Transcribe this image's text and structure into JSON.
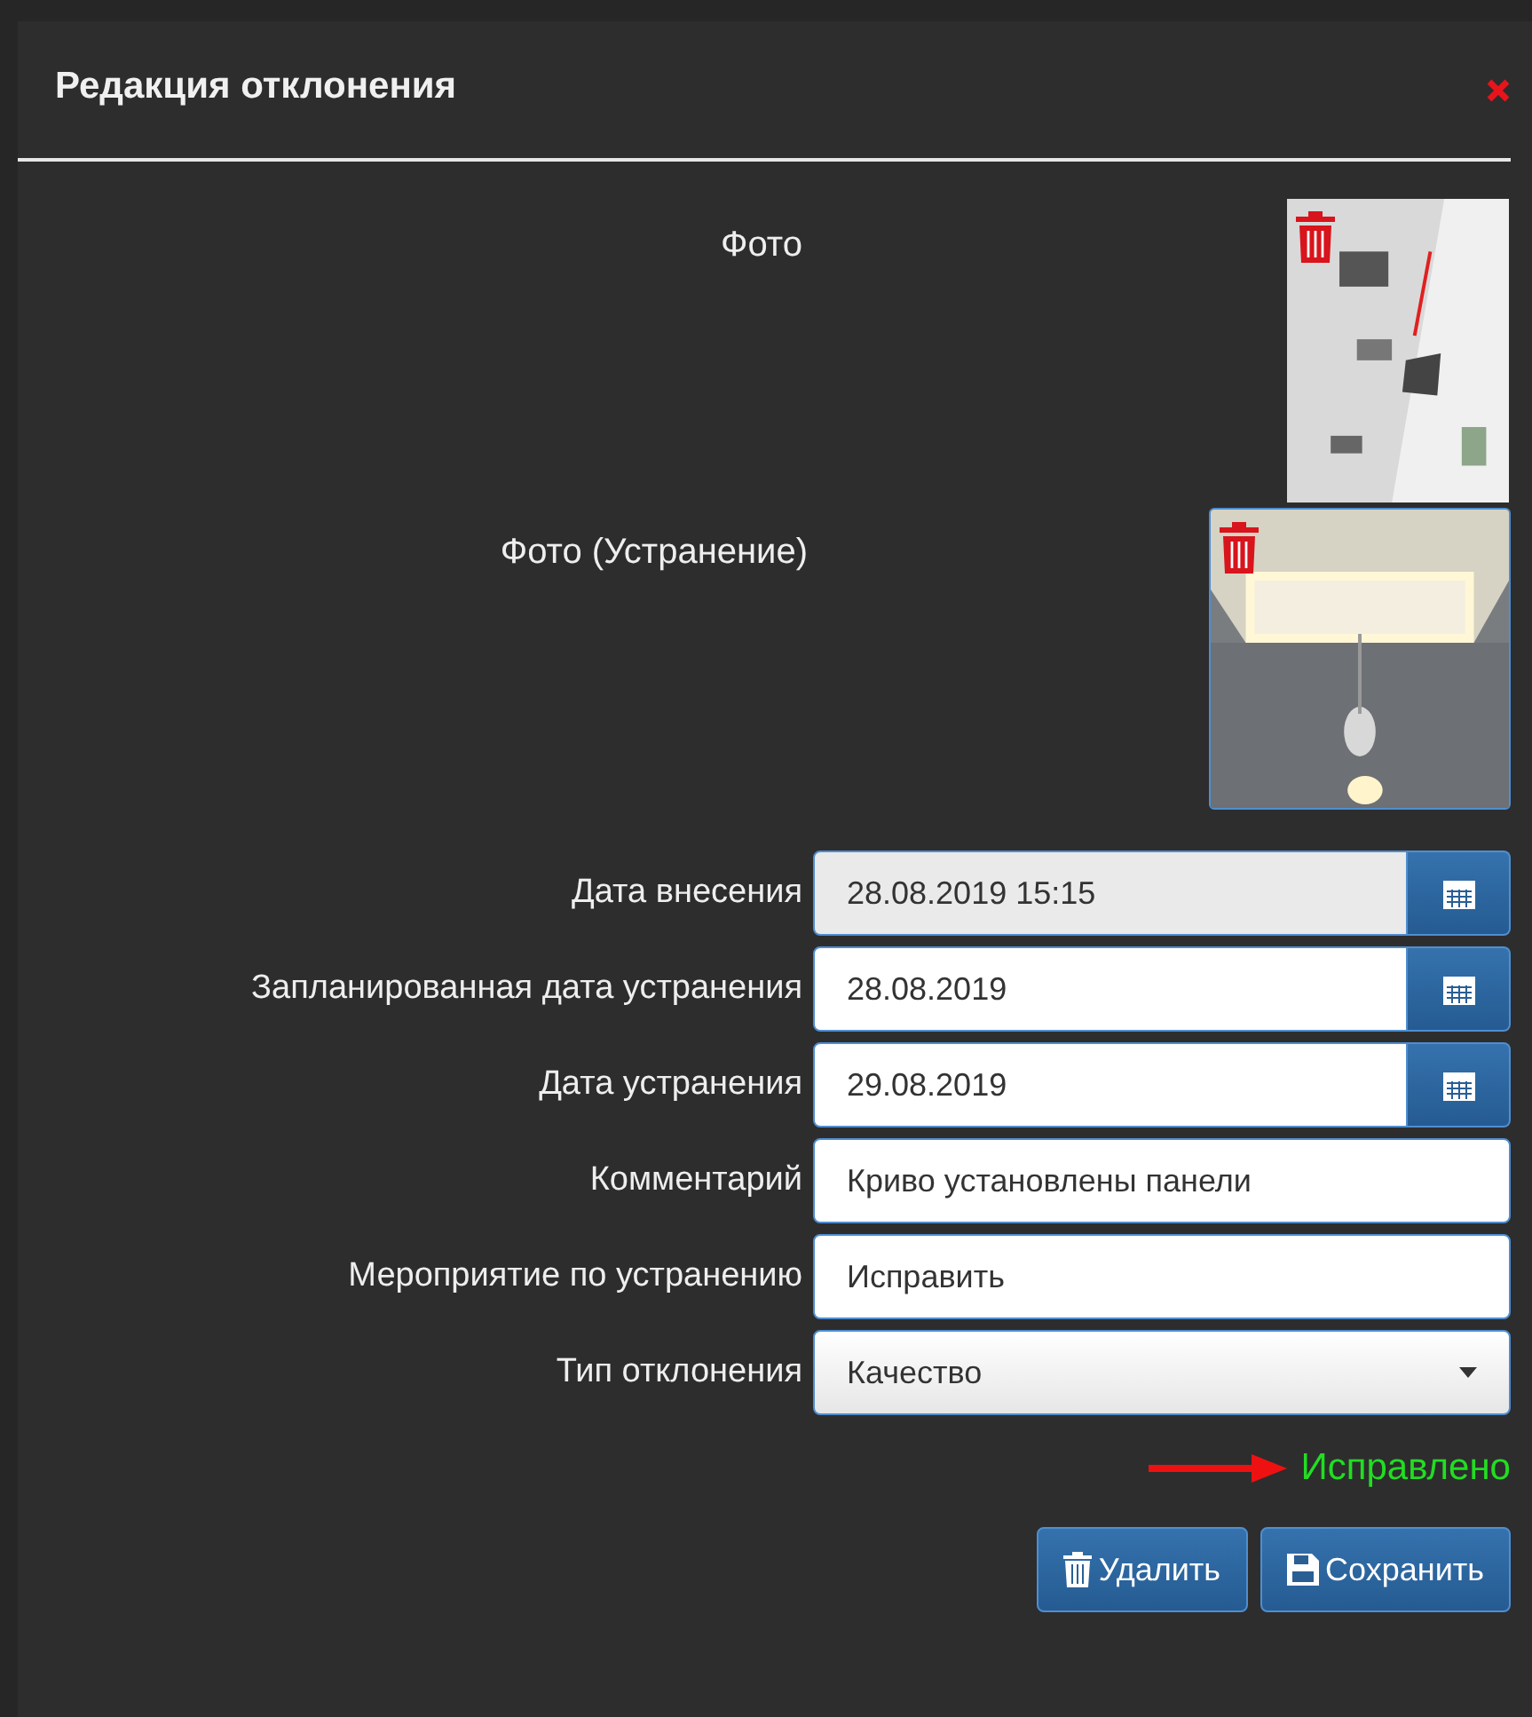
{
  "dialog": {
    "title": "Редакция отклонения"
  },
  "photos": [
    {
      "label": "Фото",
      "highlighted": false
    },
    {
      "label": "Фото (Устранение)",
      "highlighted": true
    }
  ],
  "fields": [
    {
      "label": "Дата внесения",
      "value": "28.08.2019 15:15",
      "kind": "date",
      "disabled": true
    },
    {
      "label": "Запланированная дата устранения",
      "value": "28.08.2019",
      "kind": "date",
      "disabled": false
    },
    {
      "label": "Дата устранения",
      "value": "29.08.2019",
      "kind": "date",
      "disabled": false
    },
    {
      "label": "Комментарий",
      "value": "Криво установлены панели",
      "kind": "text",
      "disabled": false
    },
    {
      "label": "Мероприятие по устранению",
      "value": "Исправить",
      "kind": "text",
      "disabled": false
    },
    {
      "label": "Тип отклонения",
      "value": "Качество",
      "kind": "select",
      "disabled": false
    }
  ],
  "status": {
    "text": "Исправлено"
  },
  "buttons": [
    {
      "label": "Удалить"
    },
    {
      "label": "Сохранить"
    }
  ]
}
